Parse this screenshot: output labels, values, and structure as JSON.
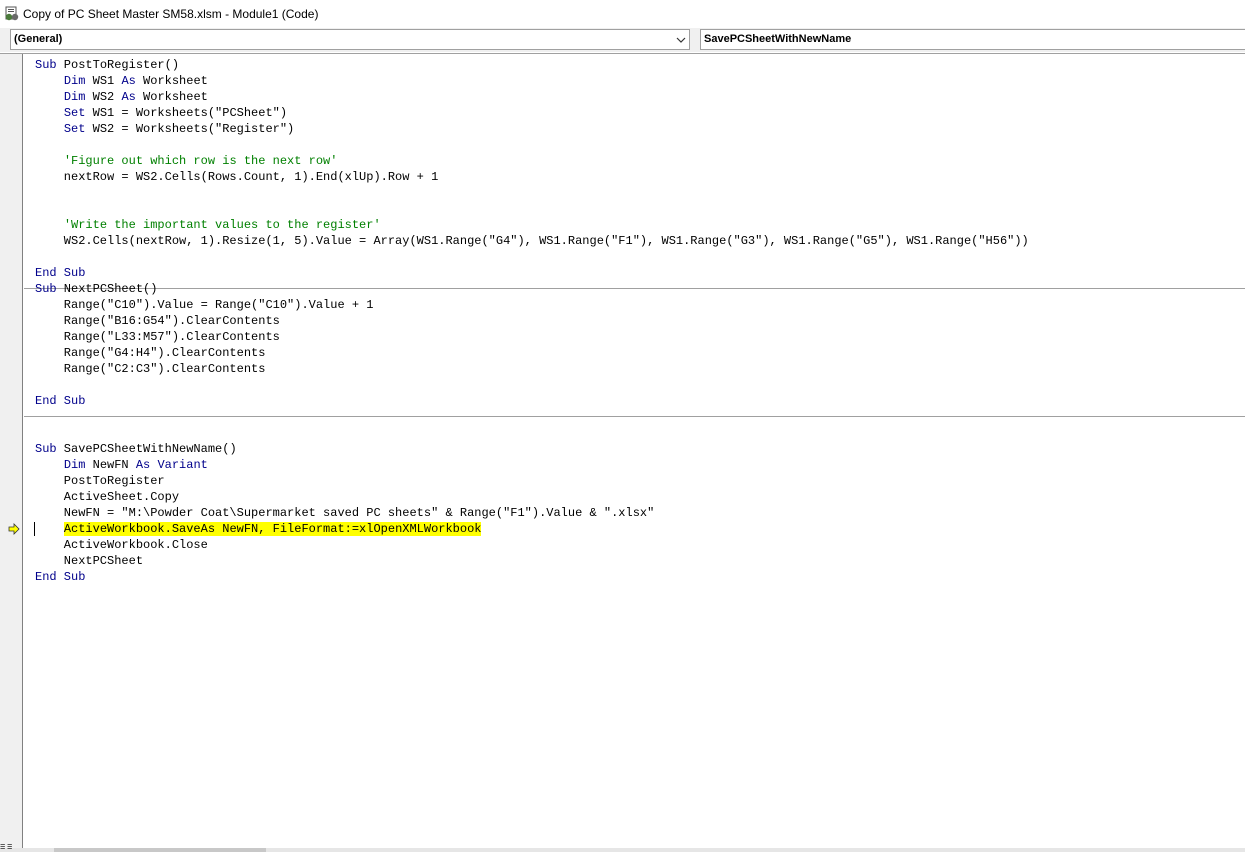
{
  "window": {
    "title": "Copy of PC Sheet Master SM58.xlsm - Module1 (Code)"
  },
  "object_combo": {
    "value": "(General)"
  },
  "procedure_combo": {
    "value": "SavePCSheetWithNewName"
  },
  "colors": {
    "keyword": "#00008b",
    "comment": "#008000",
    "exec_highlight": "#ffff00"
  },
  "icons": {
    "app": "vba-module-icon",
    "dropdown": "chevron-down-icon",
    "exec": "execution-arrow-icon"
  },
  "code": {
    "lines": [
      [
        {
          "t": "kw",
          "v": "Sub"
        },
        {
          "t": "n",
          "v": " PostToRegister()"
        }
      ],
      [
        {
          "t": "n",
          "v": "    "
        },
        {
          "t": "kw",
          "v": "Dim"
        },
        {
          "t": "n",
          "v": " WS1 "
        },
        {
          "t": "kw",
          "v": "As"
        },
        {
          "t": "n",
          "v": " Worksheet"
        }
      ],
      [
        {
          "t": "n",
          "v": "    "
        },
        {
          "t": "kw",
          "v": "Dim"
        },
        {
          "t": "n",
          "v": " WS2 "
        },
        {
          "t": "kw",
          "v": "As"
        },
        {
          "t": "n",
          "v": " Worksheet"
        }
      ],
      [
        {
          "t": "n",
          "v": "    "
        },
        {
          "t": "kw",
          "v": "Set"
        },
        {
          "t": "n",
          "v": " WS1 = Worksheets(\"PCSheet\")"
        }
      ],
      [
        {
          "t": "n",
          "v": "    "
        },
        {
          "t": "kw",
          "v": "Set"
        },
        {
          "t": "n",
          "v": " WS2 = Worksheets(\"Register\")"
        }
      ],
      [],
      [
        {
          "t": "n",
          "v": "    "
        },
        {
          "t": "cm",
          "v": "'Figure out which row is the next row'"
        }
      ],
      [
        {
          "t": "n",
          "v": "    nextRow = WS2.Cells(Rows.Count, 1).End(xlUp).Row + 1"
        }
      ],
      [],
      [],
      [
        {
          "t": "n",
          "v": "    "
        },
        {
          "t": "cm",
          "v": "'Write the important values to the register'"
        }
      ],
      [
        {
          "t": "n",
          "v": "    WS2.Cells(nextRow, 1).Resize(1, 5).Value = Array(WS1.Range(\"G4\"), WS1.Range(\"F1\"), WS1.Range(\"G3\"), WS1.Range(\"G5\"), WS1.Range(\"H56\"))"
        }
      ],
      [],
      [
        {
          "t": "kw",
          "v": "End Sub"
        }
      ],
      "SEP",
      [
        {
          "t": "kw",
          "v": "Sub"
        },
        {
          "t": "n",
          "v": " NextPCSheet()"
        }
      ],
      [
        {
          "t": "n",
          "v": "    Range(\"C10\").Value = Range(\"C10\").Value + 1"
        }
      ],
      [
        {
          "t": "n",
          "v": "    Range(\"B16:G54\").ClearContents"
        }
      ],
      [
        {
          "t": "n",
          "v": "    Range(\"L33:M57\").ClearContents"
        }
      ],
      [
        {
          "t": "n",
          "v": "    Range(\"G4:H4\").ClearContents"
        }
      ],
      [
        {
          "t": "n",
          "v": "    Range(\"C2:C3\").ClearContents"
        }
      ],
      [],
      [
        {
          "t": "kw",
          "v": "End Sub"
        }
      ],
      "SEP",
      [],
      [],
      [
        {
          "t": "kw",
          "v": "Sub"
        },
        {
          "t": "n",
          "v": " SavePCSheetWithNewName()"
        }
      ],
      [
        {
          "t": "n",
          "v": "    "
        },
        {
          "t": "kw",
          "v": "Dim"
        },
        {
          "t": "n",
          "v": " NewFN "
        },
        {
          "t": "kw",
          "v": "As"
        },
        {
          "t": "n",
          "v": " "
        },
        {
          "t": "kw",
          "v": "Variant"
        }
      ],
      [
        {
          "t": "n",
          "v": "    PostToRegister"
        }
      ],
      [
        {
          "t": "n",
          "v": "    ActiveSheet.Copy"
        }
      ],
      [
        {
          "t": "n",
          "v": "    NewFN = \"M:\\Powder Coat\\Supermarket saved PC sheets\" & Range(\"F1\").Value & \".xlsx\""
        }
      ],
      [
        {
          "t": "n",
          "v": "    "
        },
        {
          "t": "hl",
          "v": "ActiveWorkbook.SaveAs NewFN, FileFormat:=xlOpenXMLWorkbook"
        }
      ],
      [
        {
          "t": "n",
          "v": "    ActiveWorkbook.Close"
        }
      ],
      [
        {
          "t": "n",
          "v": "    NextPCSheet"
        }
      ],
      [
        {
          "t": "kw",
          "v": "End Sub"
        }
      ]
    ],
    "exec_line_index": 31
  }
}
